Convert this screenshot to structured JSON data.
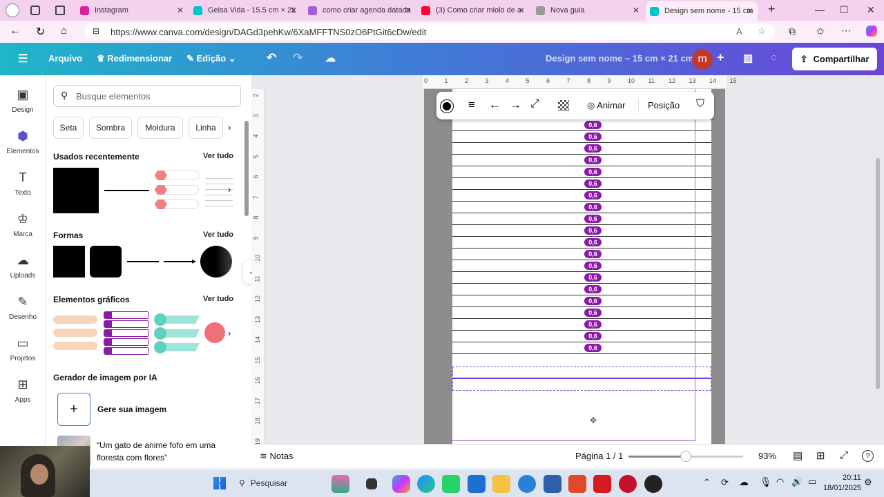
{
  "browser": {
    "tabs": [
      {
        "label": "Instagram",
        "color": "#d6249f"
      },
      {
        "label": "Geisa Vida - 15.5 cm × 21",
        "color": "#00c4cc"
      },
      {
        "label": "como criar agenda datada",
        "color": "#a25ddc"
      },
      {
        "label": "(3) Como criar miolo de a",
        "color": "#ff0033"
      },
      {
        "label": "Nova guia",
        "color": "#999999"
      },
      {
        "label": "Design sem nome - 15 cm",
        "color": "#00c4cc"
      }
    ],
    "url": "https://www.canva.com/design/DAGd3pehKw/6XaMFFTNS0zO6PtGit6cDw/edit"
  },
  "header": {
    "menu_icon": "hamburger-icon",
    "file": "Arquivo",
    "resize": "Redimensionar",
    "edit": "Edição",
    "title": "Design sem nome – 15 cm × 21 cm",
    "avatar": "m",
    "share": "Compartilhar"
  },
  "leftnav": [
    {
      "label": "Design",
      "icon": "design-icon"
    },
    {
      "label": "Elementos",
      "icon": "elements-icon"
    },
    {
      "label": "Texto",
      "icon": "text-icon"
    },
    {
      "label": "Marca",
      "icon": "brand-icon"
    },
    {
      "label": "Uploads",
      "icon": "upload-icon"
    },
    {
      "label": "Desenho",
      "icon": "draw-icon"
    },
    {
      "label": "Projetos",
      "icon": "folder-icon"
    },
    {
      "label": "Apps",
      "icon": "apps-icon"
    }
  ],
  "panel": {
    "search_placeholder": "Busque elementos",
    "chips": [
      "Seta",
      "Sombra",
      "Moldura",
      "Linha"
    ],
    "recent_title": "Usados recentemente",
    "shapes_title": "Formas",
    "graphics_title": "Elementos gráficos",
    "see_all": "Ver tudo",
    "ai_title": "Gerador de imagem por IA",
    "ai_generate": "Gere sua imagem",
    "ai_prompt": "“Um gato de anime fofo em uma floresta com flores”"
  },
  "toolbar": {
    "animate": "Animar",
    "position": "Posição"
  },
  "ruler": {
    "h": [
      "0",
      "1",
      "2",
      "3",
      "4",
      "5",
      "6",
      "7",
      "8",
      "9",
      "10",
      "11",
      "12",
      "13",
      "14",
      "15"
    ],
    "v": [
      "2",
      "3",
      "4",
      "5",
      "6",
      "7",
      "8",
      "9",
      "10",
      "11",
      "12",
      "13",
      "14",
      "15",
      "16",
      "17",
      "18",
      "19"
    ]
  },
  "badges": [
    "0,6",
    "0,6",
    "0,6",
    "0,6",
    "0,6",
    "0,6",
    "0,6",
    "0,6",
    "0,6",
    "0,6",
    "0,6",
    "0,6",
    "0,6",
    "0,6",
    "0,6",
    "0,6",
    "0,6",
    "0,6",
    "0,6",
    "0,6",
    "0,6"
  ],
  "bottombar": {
    "notes": "Notas",
    "page": "Página 1 / 1",
    "zoom": "93%",
    "zoom_fraction": 0.5
  },
  "taskbar": {
    "search": "Pesquisar",
    "time": "20:11",
    "date": "18/01/2025"
  }
}
